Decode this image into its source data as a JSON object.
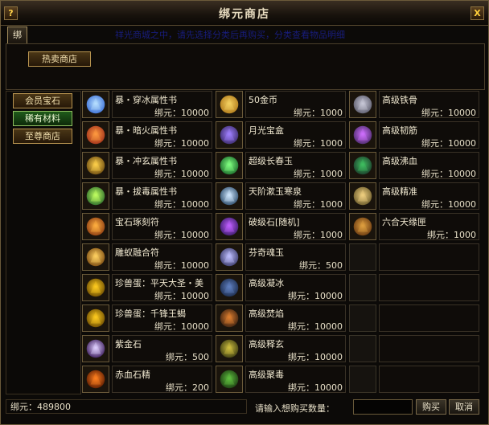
{
  "window": {
    "title": "绑元商店",
    "help_icon": "?",
    "close_icon": "X"
  },
  "tab": {
    "label": "绑定元宝商店"
  },
  "marquee": "祥光商城之中，请先选择分类后再购买，分类查看物品明细",
  "top_buttons": {
    "hot_shop": "热卖商店"
  },
  "categories": [
    {
      "label": "会员宝石",
      "selected": false
    },
    {
      "label": "稀有材料",
      "selected": true
    },
    {
      "label": "至尊商店",
      "selected": false
    }
  ],
  "items": [
    {
      "name": "暴・穿冰属性书",
      "price": "绑元：10000",
      "icon": "book-ice-icon"
    },
    {
      "name": "50金币",
      "price": "绑元：1000",
      "icon": "gold-coin-icon"
    },
    {
      "name": "高级铁骨",
      "price": "绑元：10000",
      "icon": "iron-bone-icon"
    },
    {
      "name": "暴・暗火属性书",
      "price": "绑元：10000",
      "icon": "book-dark-fire-icon"
    },
    {
      "name": "月光宝盒",
      "price": "绑元：1000",
      "icon": "moonlight-box-icon"
    },
    {
      "name": "高级韧筋",
      "price": "绑元：10000",
      "icon": "tendon-icon"
    },
    {
      "name": "暴・冲玄属性书",
      "price": "绑元：10000",
      "icon": "book-mystic-icon"
    },
    {
      "name": "超级长春玉",
      "price": "绑元：1000",
      "icon": "jade-icon"
    },
    {
      "name": "高级沸血",
      "price": "绑元：10000",
      "icon": "boiling-blood-icon"
    },
    {
      "name": "暴・拔毒属性书",
      "price": "绑元：10000",
      "icon": "book-poison-icon"
    },
    {
      "name": "天阶漱玉寒泉",
      "price": "绑元：1000",
      "icon": "cold-spring-icon"
    },
    {
      "name": "高级精准",
      "price": "绑元：10000",
      "icon": "precision-icon"
    },
    {
      "name": "宝石琢刻符",
      "price": "绑元：10000",
      "icon": "gem-carving-rune-icon"
    },
    {
      "name": "破级石[随机]",
      "price": "绑元：1000",
      "icon": "break-stone-icon"
    },
    {
      "name": "六合天缘匣",
      "price": "绑元：1000",
      "icon": "treasure-chest-icon"
    },
    {
      "name": "雕蚁融合符",
      "price": "绑元：10000",
      "icon": "fusion-rune-icon"
    },
    {
      "name": "芬奇魂玉",
      "price": "绑元：500",
      "icon": "soul-jade-icon"
    },
    {
      "name": "",
      "price": "",
      "icon": ""
    },
    {
      "name": "珍兽蛋：平天大圣・美",
      "price": "绑元：10000",
      "icon": "beast-egg-icon"
    },
    {
      "name": "高级凝冰",
      "price": "绑元：10000",
      "icon": "frost-icon"
    },
    {
      "name": "",
      "price": "",
      "icon": ""
    },
    {
      "name": "珍兽蛋：千锋王蝎",
      "price": "绑元：10000",
      "icon": "beast-egg-scorpion-icon"
    },
    {
      "name": "高级焚焰",
      "price": "绑元：10000",
      "icon": "blaze-icon"
    },
    {
      "name": "",
      "price": "",
      "icon": ""
    },
    {
      "name": "紫金石",
      "price": "绑元：500",
      "icon": "purple-gold-stone-icon"
    },
    {
      "name": "高级释玄",
      "price": "绑元：10000",
      "icon": "release-mystic-icon"
    },
    {
      "name": "",
      "price": "",
      "icon": ""
    },
    {
      "name": "赤血石精",
      "price": "绑元：200",
      "icon": "crimson-stone-icon"
    },
    {
      "name": "高级聚毒",
      "price": "绑元：10000",
      "icon": "gather-poison-icon"
    },
    {
      "name": "",
      "price": "",
      "icon": ""
    }
  ],
  "footer": {
    "balance": "绑元：489800",
    "prompt": "请输入想购买数量：",
    "quantity_value": "",
    "buy": "购买",
    "cancel": "取消"
  }
}
